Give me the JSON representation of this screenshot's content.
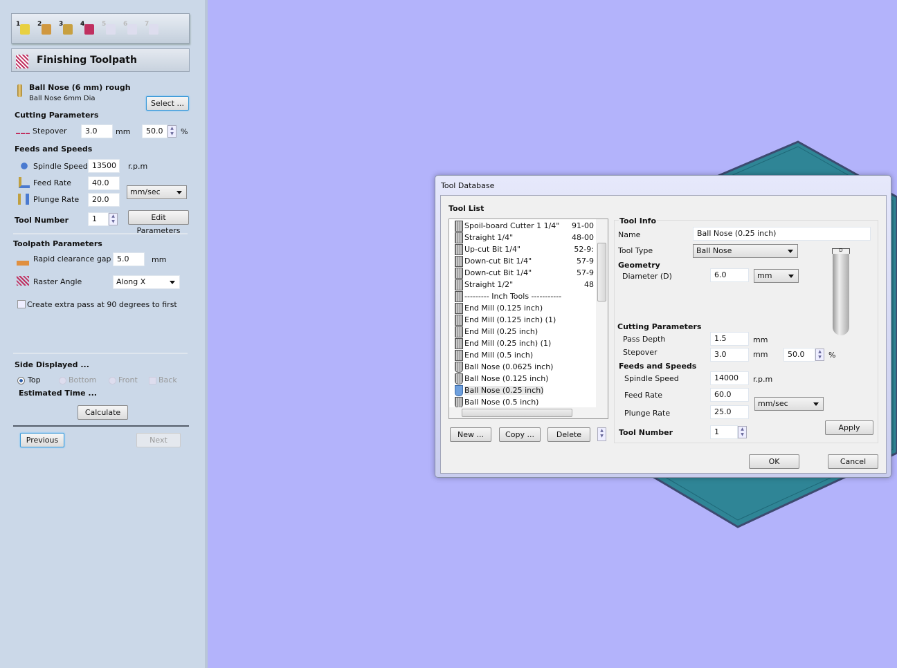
{
  "left_panel": {
    "wizard_steps": [
      "1",
      "2",
      "3",
      "4",
      "5",
      "6",
      "7"
    ],
    "header_title": "Finishing Toolpath",
    "tool_name": "Ball Nose (6 mm) rough",
    "tool_desc": "Ball Nose 6mm Dia",
    "select_label": "Select ...",
    "cutting_params_heading": "Cutting Parameters",
    "stepover_label": "Stepover",
    "stepover_value": "3.0",
    "stepover_unit": "mm",
    "stepover_pct": "50.0",
    "pct_sign": "%",
    "feeds_heading": "Feeds and Speeds",
    "spindle_label": "Spindle Speed",
    "spindle_value": "13500",
    "spindle_unit": "r.p.m",
    "feed_label": "Feed Rate",
    "feed_value": "40.0",
    "plunge_label": "Plunge Rate",
    "plunge_value": "20.0",
    "rate_unit": "mm/sec",
    "tool_number_label": "Tool Number",
    "tool_number_value": "1",
    "edit_params_label": "Edit Parameters",
    "toolpath_params_heading": "Toolpath Parameters",
    "rapid_label": "Rapid clearance gap",
    "rapid_value": "5.0",
    "rapid_unit": "mm",
    "raster_label": "Raster Angle",
    "raster_value": "Along X",
    "extra_pass_label": "Create extra pass at 90 degrees to first",
    "extra_pass_checked": false,
    "side_heading": "Side Displayed ...",
    "sides": [
      "Top",
      "Bottom",
      "Front",
      "Back"
    ],
    "side_selected": "Top",
    "est_time_heading": "Estimated Time ...",
    "calculate_label": "Calculate",
    "previous_label": "Previous",
    "next_label": "Next"
  },
  "dialog": {
    "title": "Tool Database",
    "tool_list_heading": "Tool List",
    "tools": [
      {
        "name": "Spoil-board Cutter   1 1/4\"",
        "num": "91-00",
        "shape": "flat"
      },
      {
        "name": "Straight 1/4\"",
        "num": "48-00",
        "shape": "flat"
      },
      {
        "name": "Up-cut Bit 1/4\"",
        "num": "52-9:",
        "shape": "flat"
      },
      {
        "name": "Down-cut Bit 1/4\"",
        "num": "57-9",
        "shape": "flat"
      },
      {
        "name": "Down-cut Bit 1/4\"",
        "num": "57-9",
        "shape": "flat"
      },
      {
        "name": "Straight 1/2\"",
        "num": "48",
        "shape": "flat"
      },
      {
        "name": "--------- Inch Tools -----------",
        "num": "",
        "shape": "flat"
      },
      {
        "name": "End Mill (0.125 inch)",
        "num": "",
        "shape": "flat"
      },
      {
        "name": "End Mill (0.125 inch) (1)",
        "num": "",
        "shape": "flat"
      },
      {
        "name": "End Mill (0.25 inch)",
        "num": "",
        "shape": "flat"
      },
      {
        "name": "End Mill (0.25 inch) (1)",
        "num": "",
        "shape": "flat"
      },
      {
        "name": "End Mill (0.5 inch)",
        "num": "",
        "shape": "flat"
      },
      {
        "name": "Ball Nose (0.0625 inch)",
        "num": "",
        "shape": "ball"
      },
      {
        "name": "Ball Nose (0.125 inch)",
        "num": "",
        "shape": "ball"
      },
      {
        "name": "Ball Nose (0.25 inch)",
        "num": "",
        "shape": "ball",
        "selected": true
      },
      {
        "name": "Ball Nose (0.5 inch)",
        "num": "",
        "shape": "ball"
      }
    ],
    "new_label": "New ...",
    "copy_label": "Copy ...",
    "delete_label": "Delete",
    "tool_info_heading": "Tool Info",
    "name_label": "Name",
    "name_value": "Ball Nose (0.25 inch)",
    "tool_type_label": "Tool Type",
    "tool_type_value": "Ball Nose",
    "geometry_heading": "Geometry",
    "diameter_label": "Diameter (D)",
    "diameter_value": "6.0",
    "diameter_unit": "mm",
    "diagram_label": "D",
    "cutting_heading": "Cutting Parameters",
    "pass_depth_label": "Pass Depth",
    "pass_depth_value": "1.5",
    "pass_depth_unit": "mm",
    "stepover_label": "Stepover",
    "stepover_value": "3.0",
    "stepover_unit": "mm",
    "stepover_pct": "50.0",
    "pct_sign": "%",
    "feeds_heading": "Feeds and Speeds",
    "spindle_label": "Spindle Speed",
    "spindle_value": "14000",
    "spindle_unit": "r.p.m",
    "feed_label": "Feed Rate",
    "feed_value": "60.0",
    "plunge_label": "Plunge Rate",
    "plunge_value": "25.0",
    "rate_unit": "mm/sec",
    "tool_number_label": "Tool Number",
    "tool_number_value": "1",
    "apply_label": "Apply",
    "ok_label": "OK",
    "cancel_label": "Cancel"
  },
  "colors": {
    "background": "#b3b3fb",
    "panel": "#cbd8e8",
    "model": "#2f8596"
  }
}
